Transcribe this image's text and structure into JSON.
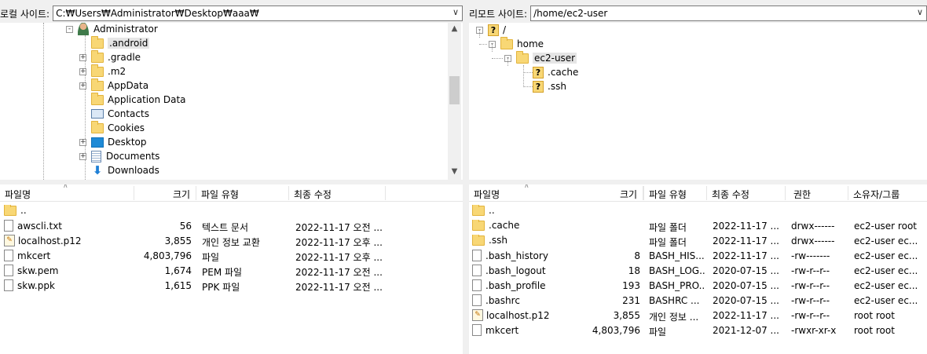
{
  "local_site": {
    "label": "로컬 사이트:",
    "path": "C:₩Users₩Administrator₩Desktop₩aaa₩",
    "tree": [
      {
        "label": "Administrator",
        "icon": "user-icon",
        "expander": "-",
        "selected": false
      },
      {
        "label": ".android",
        "icon": "folder-icon",
        "expander": "",
        "selected": true
      },
      {
        "label": ".gradle",
        "icon": "folder-icon",
        "expander": "+",
        "selected": false
      },
      {
        "label": ".m2",
        "icon": "folder-icon",
        "expander": "+",
        "selected": false
      },
      {
        "label": "AppData",
        "icon": "folder-icon",
        "expander": "+",
        "selected": false
      },
      {
        "label": "Application Data",
        "icon": "folder-icon",
        "expander": "",
        "selected": false
      },
      {
        "label": "Contacts",
        "icon": "contacts-icon",
        "expander": "",
        "selected": false
      },
      {
        "label": "Cookies",
        "icon": "folder-icon",
        "expander": "",
        "selected": false
      },
      {
        "label": "Desktop",
        "icon": "desktop-icon",
        "expander": "+",
        "selected": false
      },
      {
        "label": "Documents",
        "icon": "documents-icon",
        "expander": "+",
        "selected": false
      },
      {
        "label": "Downloads",
        "icon": "downloads-icon",
        "expander": "",
        "selected": false
      }
    ],
    "columns": [
      "파일명",
      "크기",
      "파일 유형",
      "최종 수정"
    ],
    "files": [
      {
        "name": "..",
        "size": "",
        "type": "",
        "modified": "",
        "icon": "folder-icon"
      },
      {
        "name": "awscli.txt",
        "size": "56",
        "type": "텍스트 문서",
        "modified": "2022-11-17 오전 ...",
        "icon": "text-file-icon"
      },
      {
        "name": "localhost.p12",
        "size": "3,855",
        "type": "개인 정보 교환",
        "modified": "2022-11-17 오후 ...",
        "icon": "certificate-icon"
      },
      {
        "name": "mkcert",
        "size": "4,803,796",
        "type": "파일",
        "modified": "2022-11-17 오후 ...",
        "icon": "file-icon"
      },
      {
        "name": "skw.pem",
        "size": "1,674",
        "type": "PEM 파일",
        "modified": "2022-11-17 오전 ...",
        "icon": "file-icon"
      },
      {
        "name": "skw.ppk",
        "size": "1,615",
        "type": "PPK 파일",
        "modified": "2022-11-17 오전 ...",
        "icon": "file-icon"
      }
    ]
  },
  "remote_site": {
    "label": "리모트 사이트:",
    "path": "/home/ec2-user",
    "tree": [
      {
        "label": "/",
        "icon": "unknown-folder-icon",
        "expander": "-"
      },
      {
        "label": "home",
        "icon": "folder-icon",
        "expander": "-"
      },
      {
        "label": "ec2-user",
        "icon": "folder-icon",
        "expander": "-",
        "selected": true
      },
      {
        "label": ".cache",
        "icon": "unknown-folder-icon",
        "expander": ""
      },
      {
        "label": ".ssh",
        "icon": "unknown-folder-icon",
        "expander": ""
      }
    ],
    "columns": [
      "파일명",
      "크기",
      "파일 유형",
      "최종 수정",
      "권한",
      "소유자/그룹"
    ],
    "files": [
      {
        "name": "..",
        "size": "",
        "type": "",
        "modified": "",
        "perm": "",
        "owner": "",
        "icon": "folder-icon"
      },
      {
        "name": ".cache",
        "size": "",
        "type": "파일 폴더",
        "modified": "2022-11-17 ...",
        "perm": "drwx------",
        "owner": "ec2-user root",
        "icon": "folder-icon"
      },
      {
        "name": ".ssh",
        "size": "",
        "type": "파일 폴더",
        "modified": "2022-11-17 ...",
        "perm": "drwx------",
        "owner": "ec2-user ec...",
        "icon": "folder-icon"
      },
      {
        "name": ".bash_history",
        "size": "8",
        "type": "BASH_HIS...",
        "modified": "2022-11-17 ...",
        "perm": "-rw-------",
        "owner": "ec2-user ec...",
        "icon": "file-icon"
      },
      {
        "name": ".bash_logout",
        "size": "18",
        "type": "BASH_LOG...",
        "modified": "2020-07-15 ...",
        "perm": "-rw-r--r--",
        "owner": "ec2-user ec...",
        "icon": "file-icon"
      },
      {
        "name": ".bash_profile",
        "size": "193",
        "type": "BASH_PRO...",
        "modified": "2020-07-15 ...",
        "perm": "-rw-r--r--",
        "owner": "ec2-user ec...",
        "icon": "file-icon"
      },
      {
        "name": ".bashrc",
        "size": "231",
        "type": "BASHRC ...",
        "modified": "2020-07-15 ...",
        "perm": "-rw-r--r--",
        "owner": "ec2-user ec...",
        "icon": "file-icon"
      },
      {
        "name": "localhost.p12",
        "size": "3,855",
        "type": "개인 정보 ...",
        "modified": "2022-11-17 ...",
        "perm": "-rw-r--r--",
        "owner": "root root",
        "icon": "certificate-icon"
      },
      {
        "name": "mkcert",
        "size": "4,803,796",
        "type": "파일",
        "modified": "2021-12-07 ...",
        "perm": "-rwxr-xr-x",
        "owner": "root root",
        "icon": "file-icon"
      }
    ]
  },
  "colors": {
    "folder": "#f8d775",
    "selection": "#e5e5e5",
    "accent": "#0078d7"
  }
}
